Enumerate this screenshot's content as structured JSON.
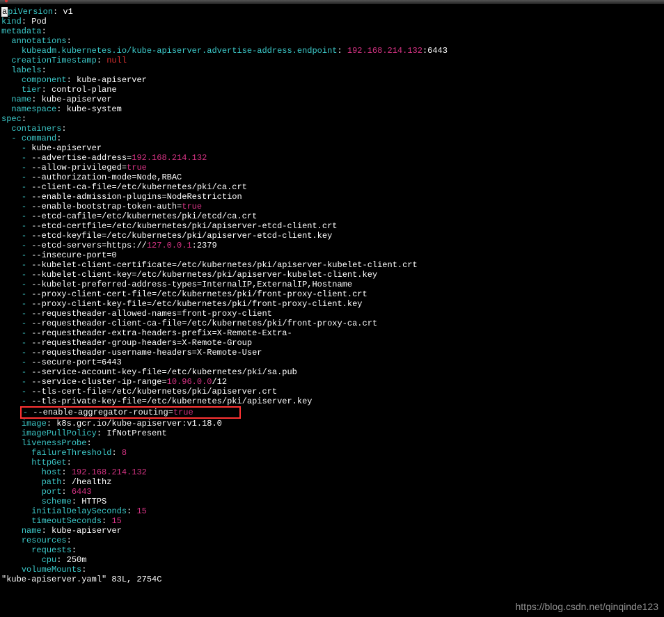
{
  "apiVersion": "v1",
  "kind": "Pod",
  "metadata": {
    "annotations": {
      "kubeadm.kubernetes.io/kube-apiserver.advertise-address.endpoint": "192.168.214.132:6443"
    },
    "creationTimestamp": "null",
    "labels": {
      "component": "kube-apiserver",
      "tier": "control-plane"
    },
    "name": "kube-apiserver",
    "namespace": "kube-system"
  },
  "spec": {
    "containers": {
      "command": [
        "kube-apiserver",
        "--advertise-address=192.168.214.132",
        "--allow-privileged=true",
        "--authorization-mode=Node,RBAC",
        "--client-ca-file=/etc/kubernetes/pki/ca.crt",
        "--enable-admission-plugins=NodeRestriction",
        "--enable-bootstrap-token-auth=true",
        "--etcd-cafile=/etc/kubernetes/pki/etcd/ca.crt",
        "--etcd-certfile=/etc/kubernetes/pki/apiserver-etcd-client.crt",
        "--etcd-keyfile=/etc/kubernetes/pki/apiserver-etcd-client.key",
        "--etcd-servers=https://127.0.0.1:2379",
        "--insecure-port=0",
        "--kubelet-client-certificate=/etc/kubernetes/pki/apiserver-kubelet-client.crt",
        "--kubelet-client-key=/etc/kubernetes/pki/apiserver-kubelet-client.key",
        "--kubelet-preferred-address-types=InternalIP,ExternalIP,Hostname",
        "--proxy-client-cert-file=/etc/kubernetes/pki/front-proxy-client.crt",
        "--proxy-client-key-file=/etc/kubernetes/pki/front-proxy-client.key",
        "--requestheader-allowed-names=front-proxy-client",
        "--requestheader-client-ca-file=/etc/kubernetes/pki/front-proxy-ca.crt",
        "--requestheader-extra-headers-prefix=X-Remote-Extra-",
        "--requestheader-group-headers=X-Remote-Group",
        "--requestheader-username-headers=X-Remote-User",
        "--secure-port=6443",
        "--service-account-key-file=/etc/kubernetes/pki/sa.pub",
        "--service-cluster-ip-range=10.96.0.0/12",
        "--tls-cert-file=/etc/kubernetes/pki/apiserver.crt",
        "--tls-private-key-file=/etc/kubernetes/pki/apiserver.key",
        "--enable-aggregator-routing=true"
      ],
      "image": "k8s.gcr.io/kube-apiserver:v1.18.0",
      "imagePullPolicy": "IfNotPresent",
      "livenessProbe": {
        "failureThreshold": "8",
        "httpGet": {
          "host": "192.168.214.132",
          "path": "/healthz",
          "port": "6443",
          "scheme": "HTTPS"
        },
        "initialDelaySeconds": "15",
        "timeoutSeconds": "15"
      },
      "name": "kube-apiserver",
      "resources": {
        "requests": {
          "cpu": "250m"
        }
      },
      "volumeMounts": true
    }
  },
  "footer": "\"kube-apiserver.yaml\" 83L, 2754C",
  "watermark": "https://blog.csdn.net/qinqinde123",
  "highlighted_line": "- --enable-aggregator-routing=true"
}
